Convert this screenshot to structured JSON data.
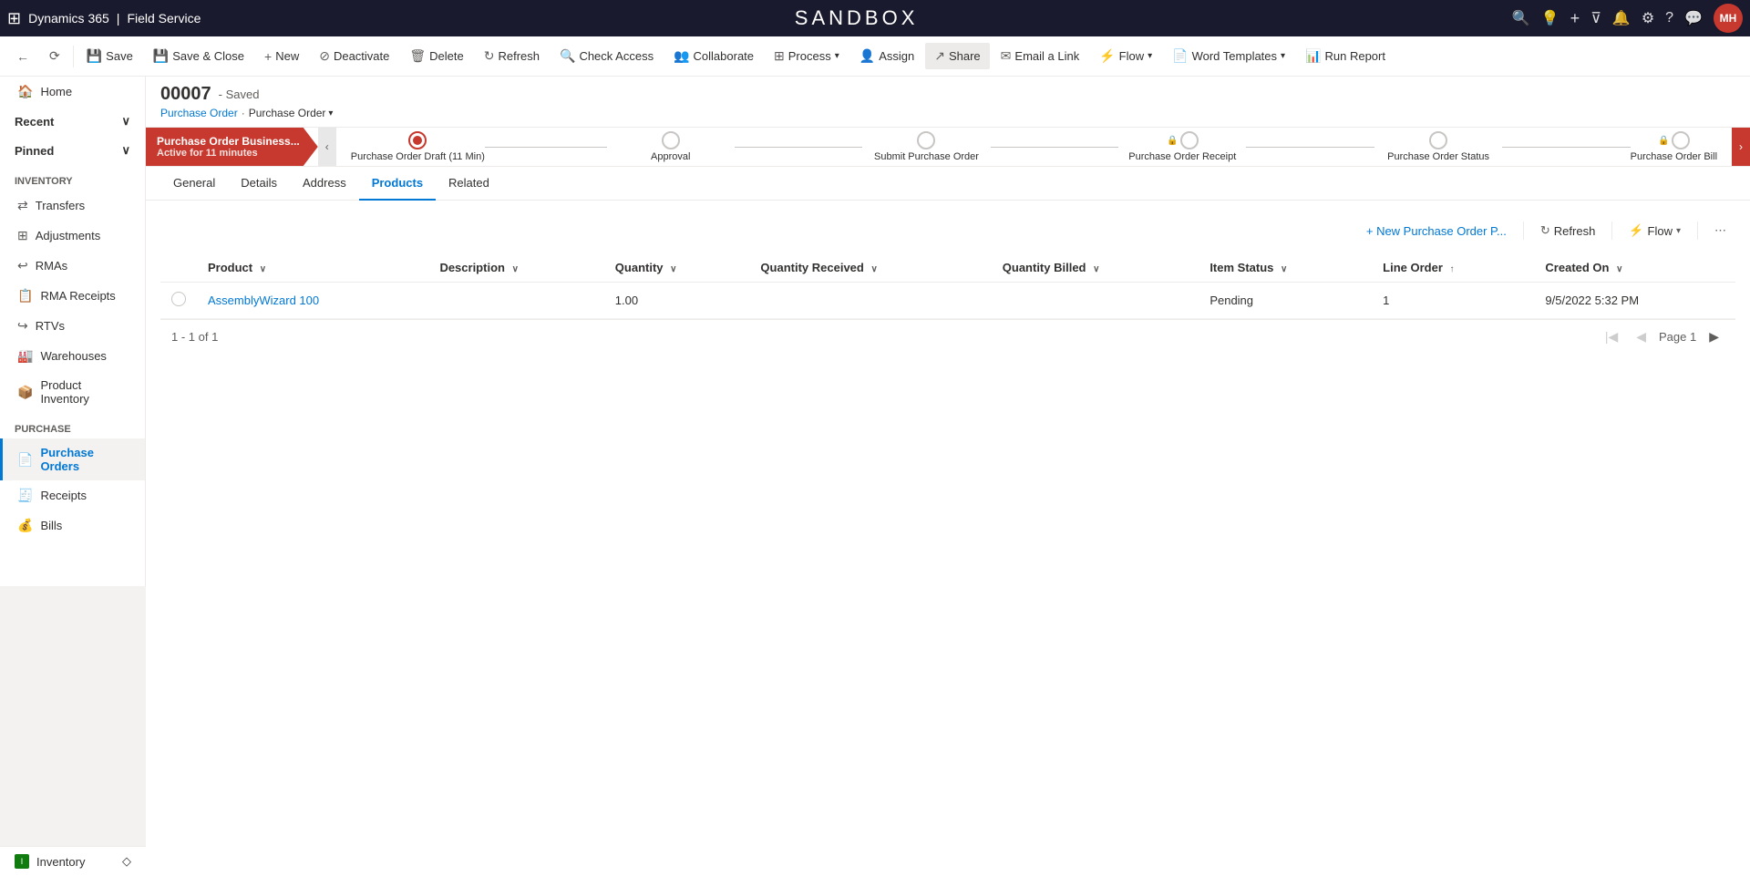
{
  "topnav": {
    "grid_icon": "⊞",
    "brand": "Dynamics 365",
    "divider": "|",
    "app_name": "Field Service",
    "sandbox_title": "SANDBOX",
    "icons": [
      "🔍",
      "💡",
      "+",
      "▽",
      "🔔",
      "⚙",
      "?",
      "💬"
    ],
    "avatar_initials": "MH",
    "avatar_bg": "#c7392e"
  },
  "commandbar": {
    "back_icon": "←",
    "forward_icon": "⟲",
    "save_label": "Save",
    "save_close_label": "Save & Close",
    "new_label": "New",
    "deactivate_label": "Deactivate",
    "delete_label": "Delete",
    "refresh_label": "Refresh",
    "check_access_label": "Check Access",
    "collaborate_label": "Collaborate",
    "process_label": "Process",
    "assign_label": "Assign",
    "share_label": "Share",
    "email_link_label": "Email a Link",
    "flow_label": "Flow",
    "word_templates_label": "Word Templates",
    "run_report_label": "Run Report"
  },
  "record": {
    "id": "00007",
    "status": "- Saved",
    "breadcrumb_entity": "Purchase Order",
    "breadcrumb_view": "Purchase Order",
    "breadcrumb_separator": "·"
  },
  "bpf": {
    "active_stage_title": "Purchase Order Business...",
    "active_stage_sub": "Active for 11 minutes",
    "stages": [
      {
        "label": "Purchase Order Draft  (11 Min)",
        "active": true,
        "locked": false
      },
      {
        "label": "Approval",
        "active": false,
        "locked": false
      },
      {
        "label": "Submit Purchase Order",
        "active": false,
        "locked": false
      },
      {
        "label": "Purchase Order Receipt",
        "active": false,
        "locked": true
      },
      {
        "label": "Purchase Order Status",
        "active": false,
        "locked": false
      },
      {
        "label": "Purchase Order Bill",
        "active": false,
        "locked": true
      }
    ]
  },
  "tabs": {
    "items": [
      "General",
      "Details",
      "Address",
      "Products",
      "Related"
    ],
    "active": "Products"
  },
  "products": {
    "toolbar": {
      "new_label": "+ New Purchase Order P...",
      "refresh_label": "Refresh",
      "flow_label": "Flow",
      "more_label": "⋯"
    },
    "columns": [
      {
        "label": "Product",
        "sortable": true
      },
      {
        "label": "Description",
        "sortable": true
      },
      {
        "label": "Quantity",
        "sortable": true
      },
      {
        "label": "Quantity Received",
        "sortable": true
      },
      {
        "label": "Quantity Billed",
        "sortable": true
      },
      {
        "label": "Item Status",
        "sortable": true
      },
      {
        "label": "Line Order",
        "sortable": true,
        "sort_dir": "asc"
      },
      {
        "label": "Created On",
        "sortable": true
      }
    ],
    "rows": [
      {
        "product": "AssemblyWizard 100",
        "description": "",
        "quantity": "1.00",
        "quantity_received": "",
        "quantity_billed": "",
        "item_status": "Pending",
        "line_order": "1",
        "created_on": "9/5/2022 5:32 PM"
      }
    ],
    "pagination": {
      "count_label": "1 - 1 of 1",
      "page_label": "Page 1"
    }
  },
  "sidebar": {
    "collapse_home": "Home",
    "collapse_recent": "Recent",
    "collapse_recent_icon": "∨",
    "collapse_pinned": "Pinned",
    "collapse_pinned_icon": "∨",
    "inventory_section": "Inventory",
    "inventory_items": [
      {
        "label": "Transfers",
        "icon": "⇄"
      },
      {
        "label": "Adjustments",
        "icon": "⊞"
      },
      {
        "label": "RMAs",
        "icon": "↩"
      },
      {
        "label": "RMA Receipts",
        "icon": "📋"
      },
      {
        "label": "RTVs",
        "icon": "↪"
      },
      {
        "label": "Warehouses",
        "icon": "🏭"
      },
      {
        "label": "Product Inventory",
        "icon": "📦"
      }
    ],
    "purchase_section": "Purchase",
    "purchase_items": [
      {
        "label": "Purchase Orders",
        "icon": "📄",
        "active": true
      },
      {
        "label": "Receipts",
        "icon": "🧾"
      },
      {
        "label": "Bills",
        "icon": "💰"
      }
    ],
    "bottom_label": "Inventory",
    "bottom_icon": "I"
  }
}
